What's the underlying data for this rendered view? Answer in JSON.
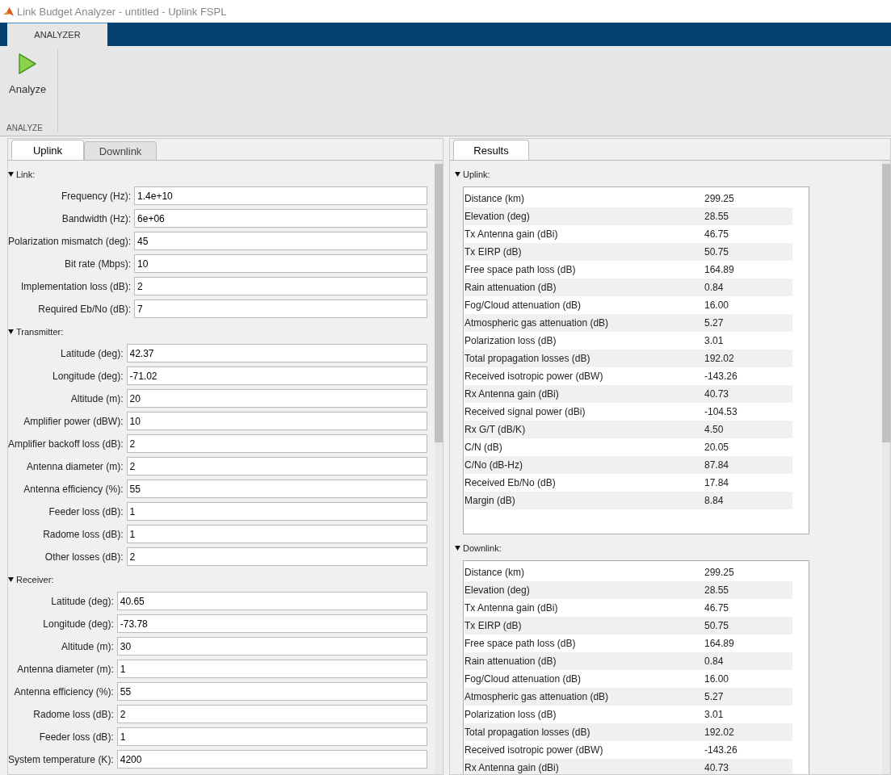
{
  "window": {
    "title": "Link Budget Analyzer - untitled - Uplink FSPL"
  },
  "toolstrip": {
    "tabs": [
      {
        "label": "ANALYZER",
        "selected": true
      }
    ],
    "buttons": [
      {
        "label": "Analyze"
      }
    ],
    "group_label": "ANALYZE"
  },
  "input_panel": {
    "tabs": [
      {
        "label": "Uplink",
        "selected": true
      },
      {
        "label": "Downlink",
        "selected": false
      }
    ],
    "sections": [
      {
        "title": "Link:",
        "expanded": true,
        "fields": [
          {
            "label": "Frequency (Hz):",
            "value": "1.4e+10"
          },
          {
            "label": "Bandwidth (Hz):",
            "value": "6e+06"
          },
          {
            "label": "Polarization mismatch (deg):",
            "value": "45"
          },
          {
            "label": "Bit rate (Mbps):",
            "value": "10"
          },
          {
            "label": "Implementation loss (dB):",
            "value": "2"
          },
          {
            "label": "Required Eb/No (dB):",
            "value": "7"
          }
        ]
      },
      {
        "title": "Transmitter:",
        "expanded": true,
        "fields": [
          {
            "label": "Latitude (deg):",
            "value": "42.37"
          },
          {
            "label": "Longitude (deg):",
            "value": "-71.02"
          },
          {
            "label": "Altitude (m):",
            "value": "20"
          },
          {
            "label": "Amplifier power (dBW):",
            "value": "10"
          },
          {
            "label": "Amplifier backoff loss (dB):",
            "value": "2"
          },
          {
            "label": "Antenna diameter (m):",
            "value": "2"
          },
          {
            "label": "Antenna efficiency (%):",
            "value": "55"
          },
          {
            "label": "Feeder loss (dB):",
            "value": "1"
          },
          {
            "label": "Radome loss (dB):",
            "value": "1"
          },
          {
            "label": "Other losses (dB):",
            "value": "2"
          }
        ]
      },
      {
        "title": "Receiver:",
        "expanded": true,
        "fields": [
          {
            "label": "Latitude (deg):",
            "value": "40.65"
          },
          {
            "label": "Longitude (deg):",
            "value": "-73.78"
          },
          {
            "label": "Altitude (m):",
            "value": "30"
          },
          {
            "label": "Antenna diameter (m):",
            "value": "1"
          },
          {
            "label": "Antenna efficiency (%):",
            "value": "55"
          },
          {
            "label": "Radome loss (dB):",
            "value": "2"
          },
          {
            "label": "Feeder loss (dB):",
            "value": "1"
          },
          {
            "label": "System temperature (K):",
            "value": "4200"
          }
        ]
      }
    ]
  },
  "results_panel": {
    "tabs": [
      {
        "label": "Results",
        "selected": true
      }
    ],
    "sections": [
      {
        "title": "Uplink:",
        "expanded": true,
        "rows": [
          {
            "name": "Distance (km)",
            "value": "299.25"
          },
          {
            "name": "Elevation (deg)",
            "value": "28.55"
          },
          {
            "name": "Tx Antenna gain (dBi)",
            "value": "46.75"
          },
          {
            "name": "Tx EIRP (dB)",
            "value": "50.75"
          },
          {
            "name": "Free space path loss (dB)",
            "value": "164.89"
          },
          {
            "name": "Rain attenuation (dB)",
            "value": "0.84"
          },
          {
            "name": "Fog/Cloud attenuation (dB)",
            "value": "16.00"
          },
          {
            "name": "Atmospheric gas attenuation (dB)",
            "value": "5.27"
          },
          {
            "name": "Polarization loss (dB)",
            "value": "3.01"
          },
          {
            "name": "Total propagation losses (dB)",
            "value": "192.02"
          },
          {
            "name": "Received isotropic power (dBW)",
            "value": "-143.26"
          },
          {
            "name": "Rx Antenna gain (dBi)",
            "value": "40.73"
          },
          {
            "name": "Received signal power (dBi)",
            "value": "-104.53"
          },
          {
            "name": "Rx G/T (dB/K)",
            "value": "4.50"
          },
          {
            "name": "C/N (dB)",
            "value": "20.05"
          },
          {
            "name": "C/No (dB-Hz)",
            "value": "87.84"
          },
          {
            "name": "Received Eb/No (dB)",
            "value": "17.84"
          },
          {
            "name": "Margin (dB)",
            "value": "8.84"
          }
        ]
      },
      {
        "title": "Downlink:",
        "expanded": true,
        "rows": [
          {
            "name": "Distance (km)",
            "value": "299.25"
          },
          {
            "name": "Elevation (deg)",
            "value": "28.55"
          },
          {
            "name": "Tx Antenna gain (dBi)",
            "value": "46.75"
          },
          {
            "name": "Tx EIRP (dB)",
            "value": "50.75"
          },
          {
            "name": "Free space path loss (dB)",
            "value": "164.89"
          },
          {
            "name": "Rain attenuation (dB)",
            "value": "0.84"
          },
          {
            "name": "Fog/Cloud attenuation (dB)",
            "value": "16.00"
          },
          {
            "name": "Atmospheric gas attenuation (dB)",
            "value": "5.27"
          },
          {
            "name": "Polarization loss (dB)",
            "value": "3.01"
          },
          {
            "name": "Total propagation losses (dB)",
            "value": "192.02"
          },
          {
            "name": "Received isotropic power (dBW)",
            "value": "-143.26"
          },
          {
            "name": "Rx Antenna gain (dBi)",
            "value": "40.73"
          }
        ]
      }
    ]
  }
}
